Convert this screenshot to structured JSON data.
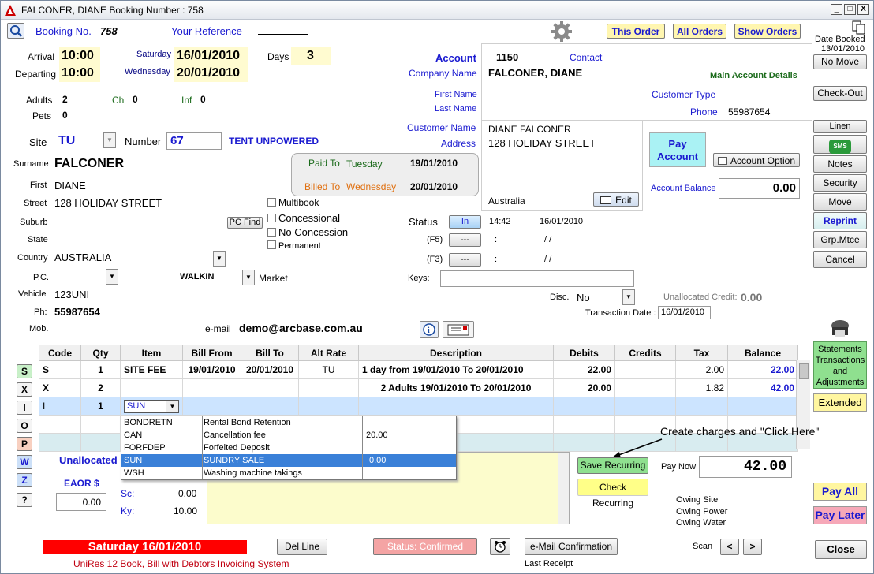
{
  "window": {
    "title": "FALCONER, DIANE  Booking Number : 758",
    "min": "_",
    "max": "□",
    "close": "X"
  },
  "header": {
    "booking_no_label": "Booking No.",
    "booking_no": "758",
    "your_reference_label": "Your Reference",
    "this_order": "This Order",
    "all_orders": "All Orders",
    "show_orders": "Show Orders",
    "date_booked_label": "Date Booked",
    "date_booked": "13/01/2010",
    "no_move": "No Move"
  },
  "stay": {
    "arrival_label": "Arrival",
    "arrival_time": "10:00",
    "arrival_day": "Saturday",
    "arrival_date": "16/01/2010",
    "departing_label": "Departing",
    "departing_time": "10:00",
    "departing_day": "Wednesday",
    "departing_date": "20/01/2010",
    "days_label": "Days",
    "days": "3"
  },
  "guests": {
    "adults_label": "Adults",
    "adults": "2",
    "ch_label": "Ch",
    "ch": "0",
    "inf_label": "Inf",
    "inf": "0",
    "pets_label": "Pets",
    "pets": "0"
  },
  "site": {
    "site_label": "Site",
    "site": "TU",
    "number_label": "Number",
    "number": "67",
    "site_type": "TENT UNPOWERED"
  },
  "paid": {
    "paid_to_label": "Paid To",
    "paid_to_day": "Tuesday",
    "paid_to_date": "19/01/2010",
    "billed_to_label": "Billed To",
    "billed_to_day": "Wednesday",
    "billed_to_date": "20/01/2010"
  },
  "customer": {
    "surname_label": "Surname",
    "surname": "FALCONER",
    "first_label": "First",
    "first": "DIANE",
    "street_label": "Street",
    "street": "128 HOLIDAY STREET",
    "suburb_label": "Suburb",
    "state_label": "State",
    "country_label": "Country",
    "country": "AUSTRALIA",
    "pc_label": "P.C.",
    "walkin": "WALKIN",
    "market": "Market",
    "vehicle_label": "Vehicle",
    "vehicle": "123UNI",
    "ph_label": "Ph:",
    "ph": "55987654",
    "mob_label": "Mob.",
    "email_label": "e-mail",
    "email": "demo@arcbase.com.au",
    "pc_find": "PC Find"
  },
  "flags": {
    "multibook": "Multibook",
    "concessional": "Concessional",
    "no_concession": "No Concession",
    "permanent": "Permanent"
  },
  "account": {
    "account_label": "Account",
    "account": "1150",
    "contact_label": "Contact",
    "company_label": "Company Name",
    "company": "FALCONER, DIANE",
    "main_details": "Main Account Details",
    "first_name_label": "First Name",
    "last_name_label": "Last Name",
    "customer_type_label": "Customer Type",
    "phone_label": "Phone",
    "phone": "55987654",
    "customer_name_label": "Customer Name",
    "customer_name": "DIANE FALCONER",
    "address_label": "Address",
    "address": "128 HOLIDAY STREET",
    "country": "Australia",
    "edit": "Edit",
    "pay_account": "Pay Account",
    "account_option": "Account Option",
    "balance_label": "Account Balance",
    "balance": "0.00"
  },
  "status": {
    "status_label": "Status",
    "in": "In",
    "in_time": "14:42",
    "in_date": "16/01/2010",
    "f5": "(F5)",
    "f3": "(F3)",
    "dash": "---",
    "colon": ":",
    "slashes": "/ /",
    "keys_label": "Keys:",
    "disc_label": "Disc.",
    "disc": "No",
    "unalloc_label": "Unallocated Credit:",
    "unalloc": "0.00",
    "trans_date_label": "Transaction Date :",
    "trans_date": "16/01/2010"
  },
  "grid": {
    "headers": [
      "Code",
      "Qty",
      "Item",
      "Bill From",
      "Bill To",
      "Alt Rate",
      "Description",
      "Debits",
      "Credits",
      "Tax",
      "Balance"
    ],
    "rows": [
      {
        "code": "S",
        "qty": "1",
        "item": "SITE FEE",
        "from": "19/01/2010",
        "to": "20/01/2010",
        "alt": "TU",
        "desc": "1 day from 19/01/2010 To 20/01/2010",
        "debits": "22.00",
        "credits": "",
        "tax": "2.00",
        "balance": "22.00"
      },
      {
        "code": "X",
        "qty": "2",
        "item": "",
        "from": "",
        "to": "",
        "alt": "",
        "desc": "2 Adults 19/01/2010 To 20/01/2010",
        "debits": "20.00",
        "credits": "",
        "tax": "1.82",
        "balance": "42.00"
      },
      {
        "code": "I",
        "qty": "1",
        "item": "SUN",
        "from": "",
        "to": "",
        "alt": "",
        "desc": "",
        "debits": "",
        "credits": "",
        "tax": "",
        "balance": ""
      }
    ]
  },
  "dropdown": [
    {
      "code": "BONDRETN",
      "name": "Rental Bond Retention",
      "amt": ""
    },
    {
      "code": "CAN",
      "name": "Cancellation fee",
      "amt": "20.00"
    },
    {
      "code": "FORFDEP",
      "name": "Forfeited Deposit",
      "amt": ""
    },
    {
      "code": "SUN",
      "name": "SUNDRY SALE",
      "amt": "0.00"
    },
    {
      "code": "WSH",
      "name": "Washing machine takings",
      "amt": ""
    }
  ],
  "side_letters": [
    "S",
    "X",
    "I",
    "O",
    "P",
    "W",
    "Z",
    "?"
  ],
  "bottom": {
    "unallocated": "Unallocated",
    "eaor": "EAOR $",
    "eaor_val": "0.00",
    "sc_label": "Sc:",
    "sc": "0.00",
    "ky_label": "Ky:",
    "ky": "10.00",
    "save_recurring": "Save Recurring",
    "check_recurring": "Check Recurring",
    "annotation": "Create charges and \"Click Here\"",
    "pay_now_label": "Pay Now",
    "pay_now": "42.00",
    "owing_site": "Owing Site",
    "owing_power": "Owing Power",
    "owing_water": "Owing Water",
    "pay_all": "Pay All",
    "pay_later": "Pay Later",
    "date_banner": "Saturday 16/01/2010",
    "system_name": "UniRes 12 Book, Bill with Debtors Invoicing System",
    "del_line": "Del Line",
    "status_confirmed": "Status: Confirmed",
    "email_conf": "e-Mail Confirmation",
    "last_receipt": "Last Receipt",
    "scan": "Scan",
    "prev": "<",
    "next": ">",
    "close": "Close"
  },
  "right": {
    "check_out": "Check-Out",
    "linen": "Linen",
    "sms": "SMS",
    "notes": "Notes",
    "security": "Security",
    "move": "Move",
    "reprint": "Reprint",
    "grp_mtce": "Grp.Mtce",
    "cancel": "Cancel",
    "statements": "Statements Transactions and Adjustments",
    "extended": "Extended"
  }
}
